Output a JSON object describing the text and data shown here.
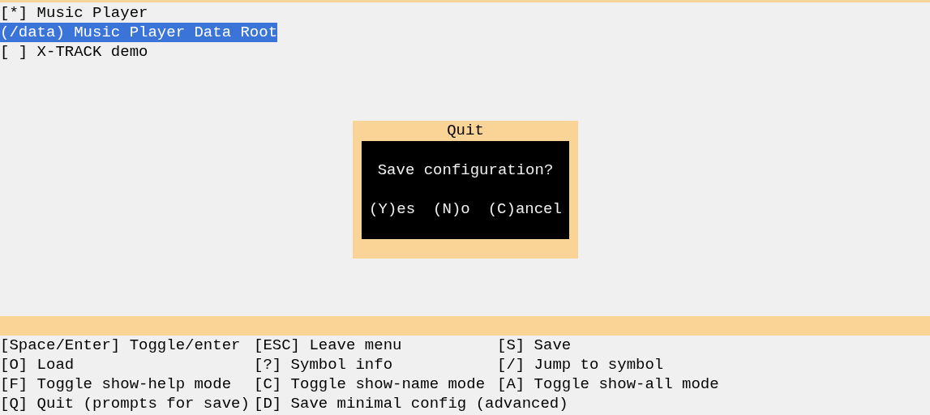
{
  "menu": {
    "items": [
      {
        "label": "[*] Music Player",
        "selected": false
      },
      {
        "label": "(/data) Music Player Data Root",
        "selected": true
      },
      {
        "label": "[ ] X-TRACK demo",
        "selected": false
      }
    ]
  },
  "dialog": {
    "title": "Quit",
    "message": "Save configuration?",
    "buttons": [
      "(Y)es",
      "(N)o",
      "(C)ancel"
    ]
  },
  "help": {
    "rows": [
      [
        "[Space/Enter] Toggle/enter",
        "[ESC] Leave menu",
        "[S] Save"
      ],
      [
        "[O] Load",
        "[?] Symbol info",
        "[/] Jump to symbol"
      ],
      [
        "[F] Toggle show-help mode",
        "[C] Toggle show-name mode",
        "[A] Toggle show-all mode"
      ],
      [
        "[Q] Quit (prompts for save)",
        "[D] Save minimal config (advanced)"
      ]
    ]
  }
}
